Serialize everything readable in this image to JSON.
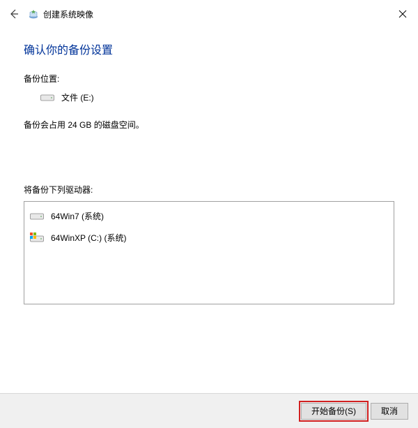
{
  "window": {
    "title": "创建系统映像"
  },
  "main": {
    "heading": "确认你的备份设置",
    "location_label": "备份位置:",
    "location_value": "文件 (E:)",
    "size_text": "备份会占用 24 GB 的磁盘空间。",
    "drives_label": "将备份下列驱动器:",
    "drives": [
      {
        "name": "64Win7  (系统)",
        "has_flag": false
      },
      {
        "name": "64WinXP  (C:) (系统)",
        "has_flag": true
      }
    ]
  },
  "footer": {
    "start_backup_label": "开始备份(S)",
    "cancel_label": "取消"
  }
}
